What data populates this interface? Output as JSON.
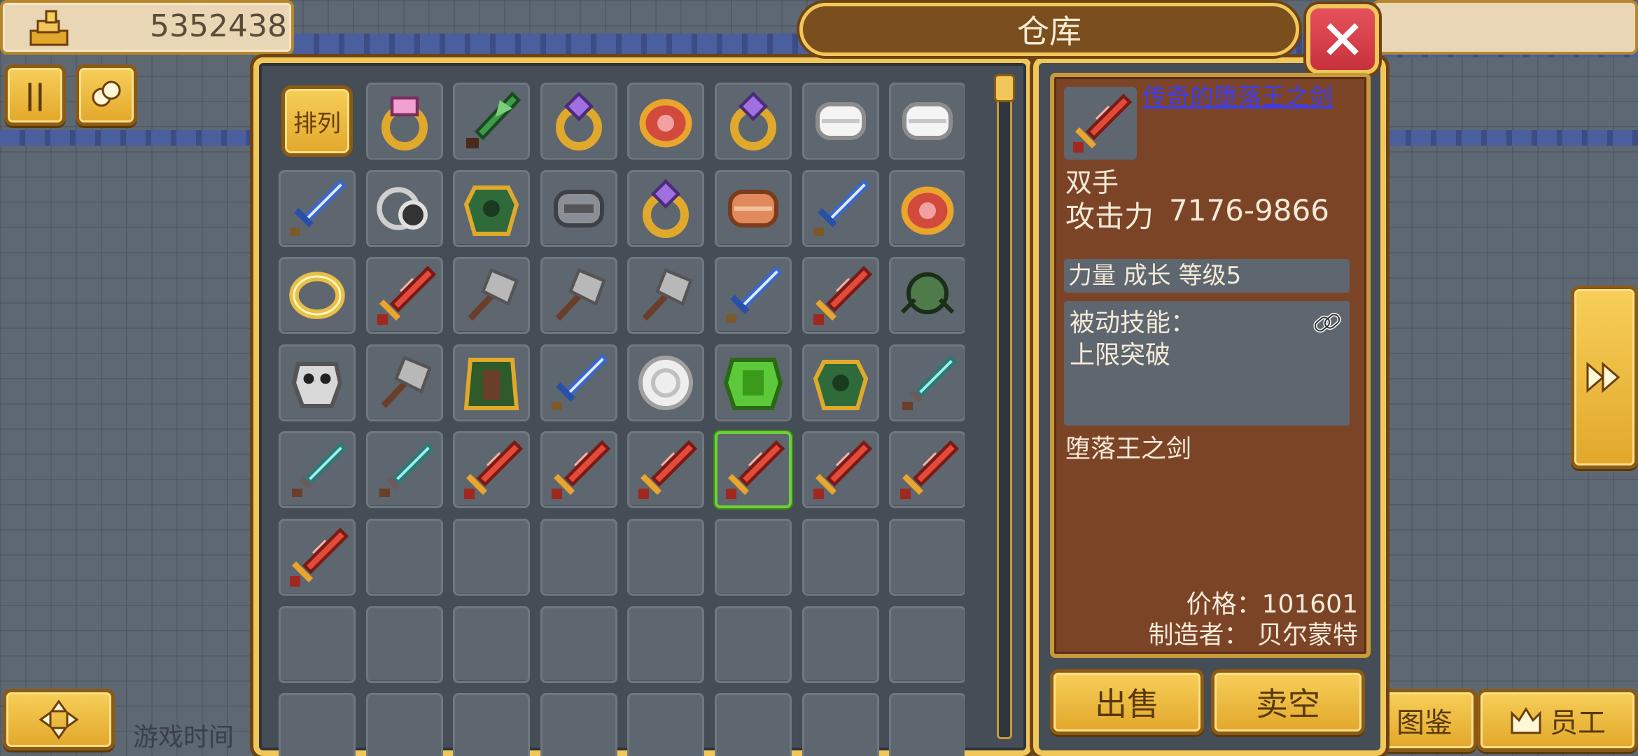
{
  "hud": {
    "gold": "5352438",
    "game_time_label": "游戏时间",
    "atlas_label": "图鉴",
    "staff_label": "员工"
  },
  "warehouse": {
    "title": "仓库",
    "sort_label": "排列",
    "slots": [
      "sort",
      "pink-gem-ring",
      "green-leaf-dagger",
      "purple-gem-ring",
      "red-gem-amulet",
      "purple-gem-ring",
      "white-bracer",
      "white-bracer",
      "steel-sword",
      "silver-chain-ring",
      "emerald-armor",
      "iron-bracer",
      "purple-gem-ring",
      "copper-bracer",
      "steel-sword",
      "red-gem-amulet",
      "gold-ring",
      "flame-greatsword",
      "war-hammer",
      "war-hammer",
      "war-hammer",
      "steel-sword",
      "flame-greatsword",
      "green-spider-helm",
      "skull-armor",
      "war-hammer",
      "green-cloak-armor",
      "steel-sword",
      "silver-shield",
      "green-plate-armor",
      "emerald-armor",
      "teal-dagger",
      "teal-dagger",
      "teal-dagger",
      "flame-greatsword",
      "flame-greatsword",
      "flame-greatsword",
      "flame-greatsword",
      "flame-greatsword",
      "flame-greatsword",
      "flame-greatsword",
      "empty",
      "empty",
      "empty",
      "empty",
      "empty",
      "empty",
      "empty",
      "empty",
      "empty",
      "empty",
      "empty",
      "empty",
      "empty",
      "empty",
      "empty",
      "empty",
      "empty",
      "empty",
      "empty",
      "empty",
      "empty",
      "empty",
      "empty"
    ],
    "selected_index": 37
  },
  "detail": {
    "name": "传奇的堕落王之剑",
    "type": "双手",
    "attack_label": "攻击力",
    "attack_value": "7176-9866",
    "attributes": "力量  成长  等级5",
    "skill_label": "被动技能：",
    "skill_value": "上限突破",
    "description": "堕落王之剑",
    "price": "价格：101601",
    "maker": "制造者： 贝尔蒙特",
    "name_color": "#3a3cf0"
  },
  "actions": {
    "sell": "出售",
    "sell_all": "卖空"
  }
}
